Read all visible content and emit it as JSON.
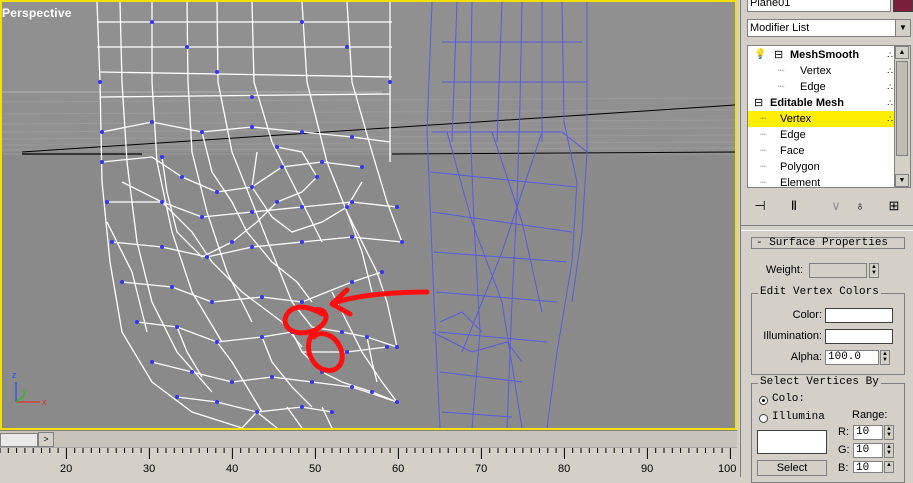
{
  "viewport": {
    "label": "Perspective",
    "axis": {
      "x": "x",
      "y": "y",
      "z": "z"
    }
  },
  "timeline": {
    "arrow": ">",
    "ticks": [
      "20",
      "30",
      "40",
      "50",
      "60",
      "70",
      "80",
      "90",
      "100"
    ]
  },
  "panel": {
    "object_name": "Plane01",
    "accent_color": "#7a1e3a",
    "modifier_list": "Modifier List",
    "stack": [
      {
        "label": "MeshSmooth",
        "bold": true
      },
      {
        "label": "Vertex"
      },
      {
        "label": "Edge"
      },
      {
        "label": "Editable Mesh",
        "bold": true
      },
      {
        "label": "Vertex",
        "selected": true
      },
      {
        "label": "Edge"
      },
      {
        "label": "Face"
      },
      {
        "label": "Polygon"
      },
      {
        "label": "Element"
      }
    ],
    "toolbar_icons": [
      "pin-stack-icon",
      "show-end-result-icon",
      "make-unique-icon",
      "remove-modifier-icon",
      "configure-modifier-sets-icon"
    ],
    "surface_properties": {
      "title": "- Surface Properties",
      "weight_label": "Weight:",
      "edit_vertex_colors": "Edit Vertex Colors",
      "color_label": "Color:",
      "illumination_label": "Illumination:",
      "alpha_label": "Alpha:",
      "alpha_value": "100.0",
      "select_vertices_by": "Select Vertices By",
      "radio_color": "Colo:",
      "radio_illum": "Illumina",
      "range_label": "Range:",
      "r_label": "R:",
      "r_value": "10",
      "g_label": "G:",
      "g_value": "10",
      "b_label": "B:",
      "b_value": "10",
      "select_button": "Select"
    }
  },
  "colors": {
    "viewport_border": "#f2e100",
    "viewport_bg": "#8a8a8a",
    "wire_white": "#ffffff",
    "wire_blue": "#5555dd",
    "vertex": "#3333ff",
    "annotation": "#ff0000",
    "selection": "#ffee00"
  }
}
